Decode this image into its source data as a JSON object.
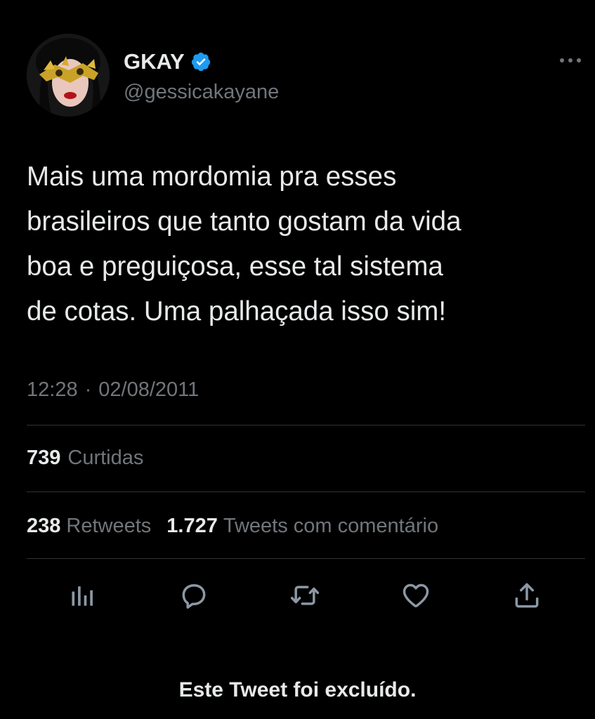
{
  "author": {
    "display_name": "GKAY",
    "handle": "@gessicakayane",
    "verified": true,
    "verified_color": "#1d9bf0"
  },
  "tweet": {
    "text": "Mais uma mordomia pra esses\nbrasileiros que tanto gostam da vida\nboa e preguiçosa, esse tal sistema\nde cotas. Uma palhaçada isso sim!",
    "time": "12:28",
    "separator": "·",
    "date": "02/08/2011"
  },
  "stats": {
    "likes_count": "739",
    "likes_label": "Curtidas",
    "retweets_count": "238",
    "retweets_label": "Retweets",
    "quotes_count": "1.727",
    "quotes_label": "Tweets com comentário"
  },
  "actions": [
    {
      "icon": "analytics-icon"
    },
    {
      "icon": "reply-icon"
    },
    {
      "icon": "retweet-icon"
    },
    {
      "icon": "like-icon"
    },
    {
      "icon": "share-icon"
    }
  ],
  "footer": {
    "deleted_notice": "Este Tweet foi excluído."
  },
  "colors": {
    "background": "#000000",
    "primary_text": "#e7e9ea",
    "secondary_text": "#71767b",
    "divider": "#2f3336",
    "icon": "#8b98a5"
  }
}
